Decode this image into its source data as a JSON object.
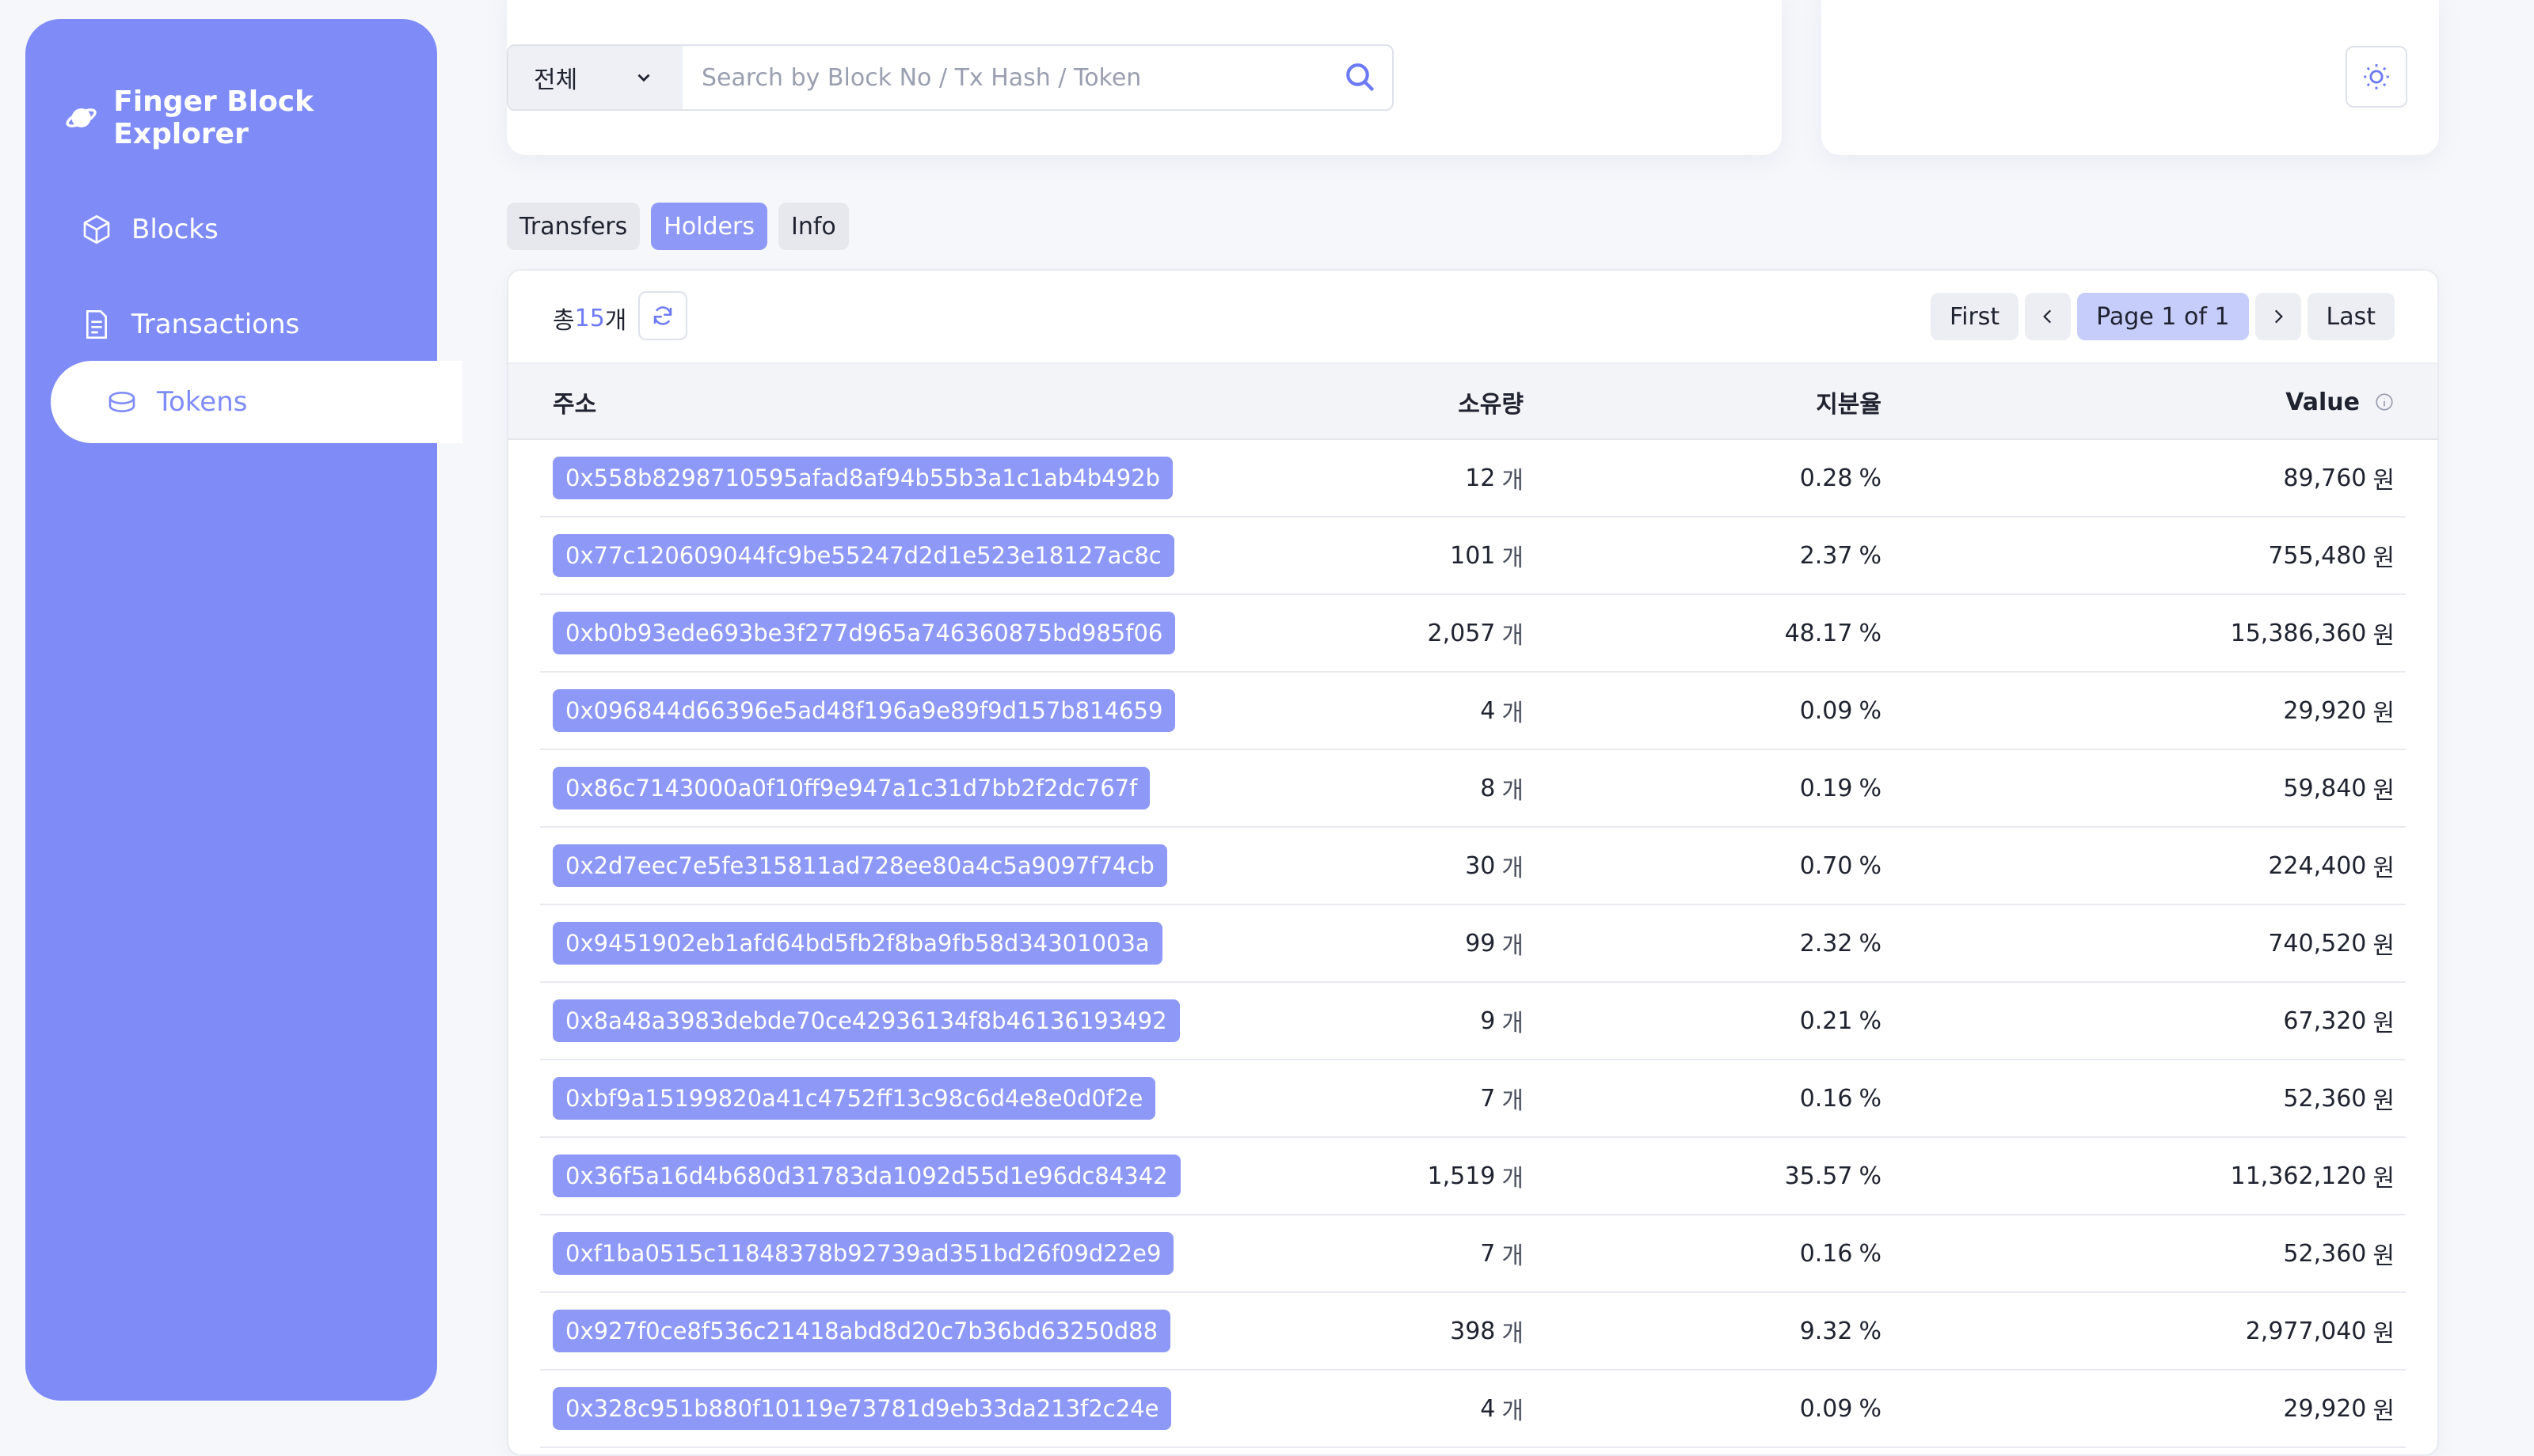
{
  "sidebar": {
    "brand": "Finger Block Explorer",
    "items": [
      {
        "label": "Blocks",
        "icon": "cube-icon"
      },
      {
        "label": "Transactions",
        "icon": "document-icon"
      },
      {
        "label": "Tokens",
        "icon": "coin-icon",
        "active": true
      }
    ]
  },
  "search": {
    "scope": "전체",
    "placeholder": "Search by Block No / Tx Hash / Token"
  },
  "tabs": [
    "Transfers",
    "Holders",
    "Info"
  ],
  "active_tab": "Holders",
  "summary": {
    "prefix": "총 ",
    "count": "15",
    "suffix": "개"
  },
  "pager": {
    "first": "First",
    "page": "Page 1 of 1",
    "last": "Last"
  },
  "table": {
    "headers": {
      "address": "주소",
      "amount": "소유량",
      "share": "지분율",
      "value": "Value"
    },
    "amount_unit": "개",
    "share_unit": "%",
    "value_unit": "원",
    "rows": [
      {
        "address": "0x558b8298710595afad8af94b55b3a1c1ab4b492b",
        "amount": "12",
        "share": "0.28",
        "value": "89,760"
      },
      {
        "address": "0x77c120609044fc9be55247d2d1e523e18127ac8c",
        "amount": "101",
        "share": "2.37",
        "value": "755,480"
      },
      {
        "address": "0xb0b93ede693be3f277d965a746360875bd985f06",
        "amount": "2,057",
        "share": "48.17",
        "value": "15,386,360"
      },
      {
        "address": "0x096844d66396e5ad48f196a9e89f9d157b814659",
        "amount": "4",
        "share": "0.09",
        "value": "29,920"
      },
      {
        "address": "0x86c7143000a0f10ff9e947a1c31d7bb2f2dc767f",
        "amount": "8",
        "share": "0.19",
        "value": "59,840"
      },
      {
        "address": "0x2d7eec7e5fe315811ad728ee80a4c5a9097f74cb",
        "amount": "30",
        "share": "0.70",
        "value": "224,400"
      },
      {
        "address": "0x9451902eb1afd64bd5fb2f8ba9fb58d34301003a",
        "amount": "99",
        "share": "2.32",
        "value": "740,520"
      },
      {
        "address": "0x8a48a3983debde70ce42936134f8b46136193492",
        "amount": "9",
        "share": "0.21",
        "value": "67,320"
      },
      {
        "address": "0xbf9a15199820a41c4752ff13c98c6d4e8e0d0f2e",
        "amount": "7",
        "share": "0.16",
        "value": "52,360"
      },
      {
        "address": "0x36f5a16d4b680d31783da1092d55d1e96dc84342",
        "amount": "1,519",
        "share": "35.57",
        "value": "11,362,120"
      },
      {
        "address": "0xf1ba0515c11848378b92739ad351bd26f09d22e9",
        "amount": "7",
        "share": "0.16",
        "value": "52,360"
      },
      {
        "address": "0x927f0ce8f536c21418abd8d20c7b36bd63250d88",
        "amount": "398",
        "share": "9.32",
        "value": "2,977,040"
      },
      {
        "address": "0x328c951b880f10119e73781d9eb33da213f2c24e",
        "amount": "4",
        "share": "0.09",
        "value": "29,920"
      }
    ]
  }
}
